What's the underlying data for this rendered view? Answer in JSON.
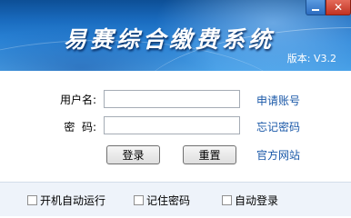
{
  "header": {
    "app_title": "易赛综合缴费系统",
    "version": "版本: V3.2"
  },
  "window_controls": {
    "minimize_glyph": "",
    "close_glyph": "✕"
  },
  "login_form": {
    "username_label": "用户名:",
    "password_label": "密  码:",
    "username_value": "",
    "password_value": "",
    "login_button": "登录",
    "reset_button": "重置"
  },
  "links": {
    "apply_account": "申请账号",
    "forgot_password": "忘记密码",
    "official_site": "官方网站"
  },
  "options": {
    "autostart": "开机自动运行",
    "remember_password": "记住密码",
    "auto_login": "自动登录"
  },
  "colors": {
    "banner_top": "#0d4f96",
    "banner_bottom": "#4aa2e8",
    "link": "#1a58a8",
    "close_button": "#c03322"
  }
}
